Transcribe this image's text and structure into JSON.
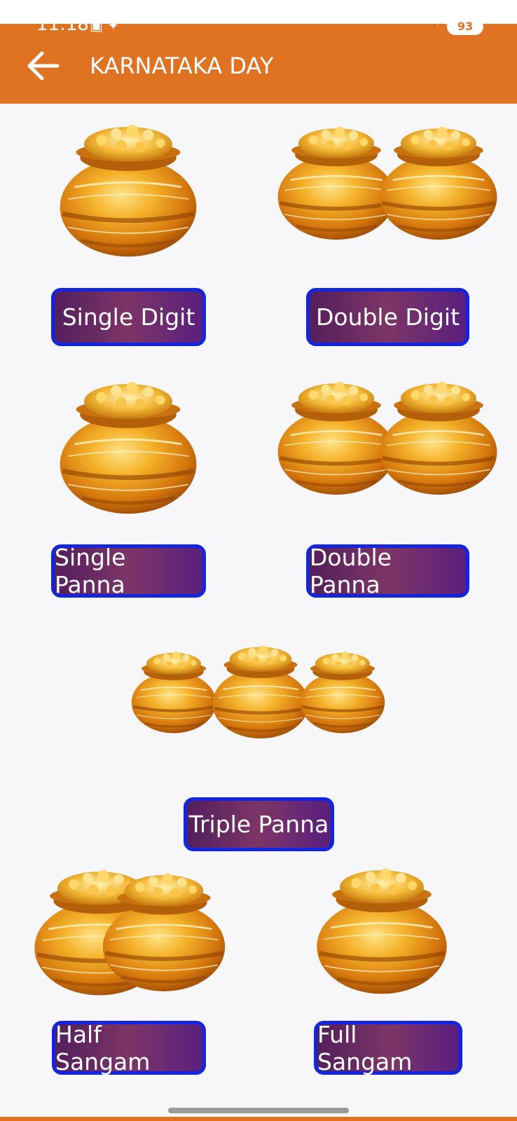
{
  "status_bar": {
    "time": "11:18",
    "battery": "93"
  },
  "header": {
    "title": "KARNATAKA DAY"
  },
  "games": [
    {
      "label": "Single Digit"
    },
    {
      "label": "Double Digit"
    },
    {
      "label": "Single Panna"
    },
    {
      "label": "Double Panna"
    },
    {
      "label": "Triple Panna"
    },
    {
      "label": "Half Sangam"
    },
    {
      "label": "Full Sangam"
    }
  ],
  "colors": {
    "accent": "#e07322",
    "button_border": "#1225e0",
    "button_fill": "#6b2a66"
  }
}
